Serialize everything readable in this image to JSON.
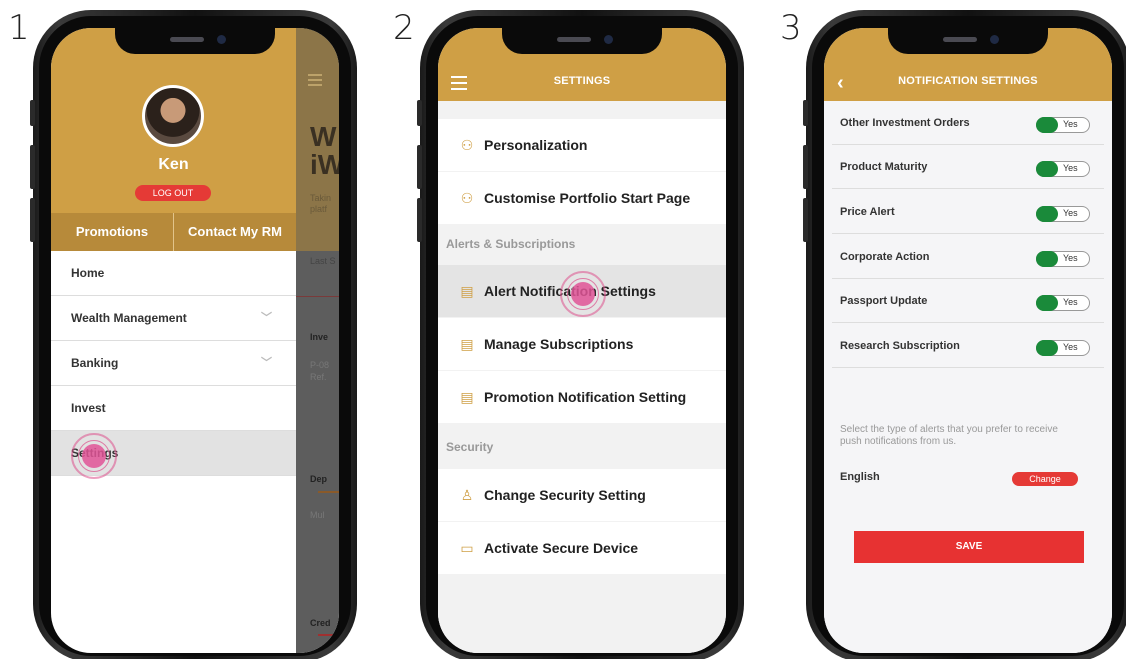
{
  "steps": [
    "1",
    "2",
    "3"
  ],
  "phone1": {
    "user_name": "Ken",
    "logout_label": "LOG OUT",
    "tabs": [
      "Promotions",
      "Contact My RM"
    ],
    "menu": [
      {
        "label": "Home",
        "expandable": false
      },
      {
        "label": "Wealth Management",
        "expandable": true
      },
      {
        "label": "Banking",
        "expandable": true
      },
      {
        "label": "Invest",
        "expandable": false
      },
      {
        "label": "Settings",
        "expandable": false,
        "active": true
      }
    ],
    "overlay": {
      "big": "W\niW",
      "line1": "Takin",
      "line2": "platf",
      "last": "Last S",
      "inv": "Inve",
      "p08": "P-08",
      "ref": "Ref.",
      "dep": "Dep",
      "mul": "Mul",
      "cred": "Cred"
    }
  },
  "phone2": {
    "title": "SETTINGS",
    "rows_top": [
      {
        "label": "Personalization",
        "icon": "user-gear-icon"
      },
      {
        "label": "Customise Portfolio Start Page",
        "icon": "user-gear-icon"
      }
    ],
    "section_alerts": "Alerts & Subscriptions",
    "rows_alerts": [
      {
        "label": "Alert Notification Settings",
        "icon": "notification-icon",
        "active": true
      },
      {
        "label": "Manage Subscriptions",
        "icon": "notification-icon"
      },
      {
        "label": "Promotion Notification Setting",
        "icon": "notification-icon"
      }
    ],
    "section_security": "Security",
    "rows_security": [
      {
        "label": "Change Security Setting",
        "icon": "user-lock-icon"
      },
      {
        "label": "Activate Secure Device",
        "icon": "device-icon"
      }
    ]
  },
  "phone3": {
    "title": "NOTIFICATION SETTINGS",
    "rows": [
      {
        "label": "Other Investment Orders",
        "value": "Yes"
      },
      {
        "label": "Product Maturity",
        "value": "Yes"
      },
      {
        "label": "Price Alert",
        "value": "Yes"
      },
      {
        "label": "Corporate Action",
        "value": "Yes"
      },
      {
        "label": "Passport Update",
        "value": "Yes"
      },
      {
        "label": "Research Subscription",
        "value": "Yes"
      }
    ],
    "hint": "Select the type of alerts that you prefer to receive push notifications from us.",
    "language": "English",
    "change_label": "Change",
    "save_label": "SAVE"
  },
  "colors": {
    "gold": "#cf9f45",
    "red": "#e53a36",
    "toggle_on": "#1a8a3a",
    "tap": "#e05496"
  }
}
